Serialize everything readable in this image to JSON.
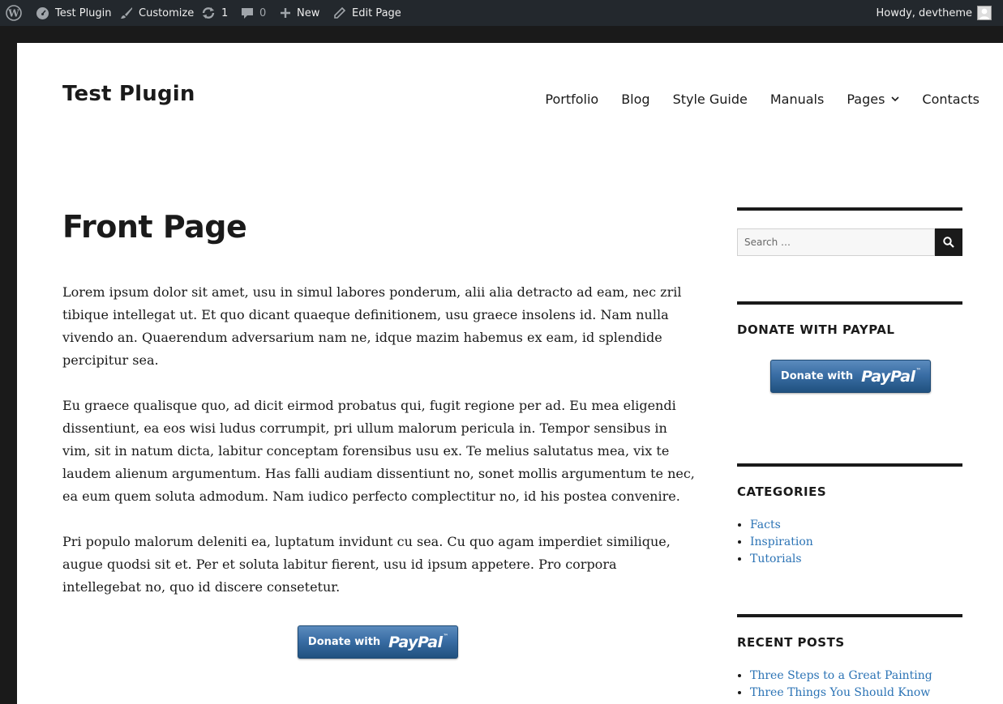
{
  "admin_bar": {
    "site_name": "Test Plugin",
    "customize": "Customize",
    "updates_count": "1",
    "comments_count": "0",
    "new_label": "New",
    "edit_label": "Edit Page",
    "howdy": "Howdy, devtheme"
  },
  "header": {
    "site_title": "Test Plugin",
    "nav": [
      "Portfolio",
      "Blog",
      "Style Guide",
      "Manuals",
      "Pages",
      "Contacts"
    ]
  },
  "main": {
    "title": "Front Page",
    "paragraphs": [
      "Lorem ipsum dolor sit amet, usu in simul labores ponderum, alii alia detracto ad eam, nec zril tibique intellegat ut. Et quo dicant quaeque definitionem, usu graece insolens id. Nam nulla vivendo an. Quaerendum adversarium nam ne, idque mazim habemus ex eam, id splendide percipitur sea.",
      "Eu graece qualisque quo, ad dicit eirmod probatus qui, fugit regione per ad. Eu mea eligendi dissentiunt, ea eos wisi ludus corrumpit, pri ullum malorum pericula in. Tempor sensibus in vim, sit in natum dicta, labitur conceptam forensibus usu ex. Te melius salutatus mea, vix te laudem alienum argumentum. Has falli audiam dissentiunt no, sonet mollis argumentum te nec, ea eum quem soluta admodum. Nam iudico perfecto complectitur no, id his postea convenire.",
      "Pri populo malorum deleniti ea, luptatum invidunt cu sea. Cu quo agam imperdiet similique, augue quodsi sit et. Per et soluta labitur fierent, usu id ipsum appetere. Pro corpora intellegebat no, quo id discere consetetur."
    ],
    "paypal": {
      "donate": "Donate with",
      "brand": "PayPal",
      "tm": "™"
    }
  },
  "sidebar": {
    "search_placeholder": "Search …",
    "donate_title": "DONATE WITH PAYPAL",
    "categories_title": "CATEGORIES",
    "categories": [
      "Facts",
      "Inspiration",
      "Tutorials"
    ],
    "recent_title": "RECENT POSTS",
    "recent_posts": [
      "Three Steps to a Great Painting",
      "Three Things You Should Know About"
    ]
  },
  "colors": {
    "admin_bar": "#23282d",
    "frame": "#1a1a1a",
    "link": "#2b73b5",
    "paypal": "#3a6ea5"
  }
}
